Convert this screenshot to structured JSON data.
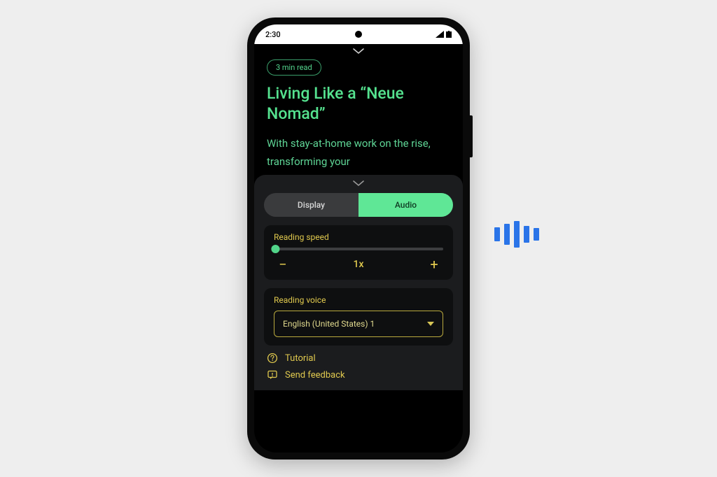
{
  "status": {
    "time": "2:30"
  },
  "article": {
    "badge": "3 min read",
    "title": "Living Like a “Neue Nomad”",
    "body": "With stay-at-home work on the rise, transforming your"
  },
  "segmented": {
    "display": "Display",
    "audio": "Audio"
  },
  "readingSpeed": {
    "label": "Reading speed",
    "value": "1x",
    "minus": "−",
    "plus": "+"
  },
  "readingVoice": {
    "label": "Reading voice",
    "value": "English (United States) 1"
  },
  "links": {
    "tutorial": "Tutorial",
    "feedback": "Send feedback"
  },
  "waveform": {
    "heights": [
      20,
      30,
      38,
      24,
      18
    ]
  }
}
